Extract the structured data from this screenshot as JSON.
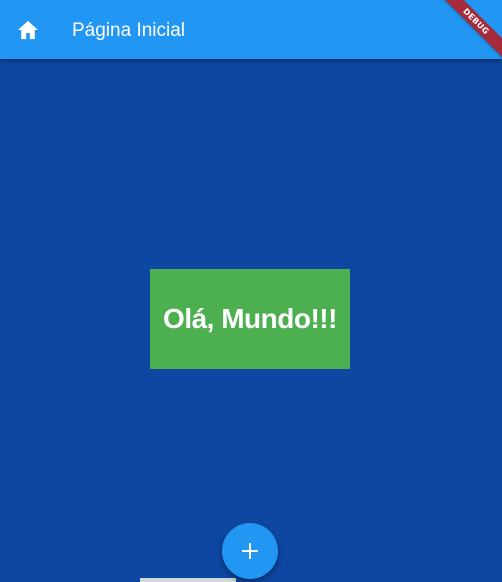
{
  "appbar": {
    "title": "Página Inicial",
    "icon": "home-icon",
    "color": "#2196f3"
  },
  "debug_banner": {
    "label": "DEBUG",
    "color": "#a52a3a"
  },
  "body": {
    "background": "#0d47a1",
    "center_box": {
      "text": "Olá, Mundo!!!",
      "color": "#4caf50"
    }
  },
  "fab": {
    "icon": "add-icon",
    "color": "#2196f3"
  }
}
